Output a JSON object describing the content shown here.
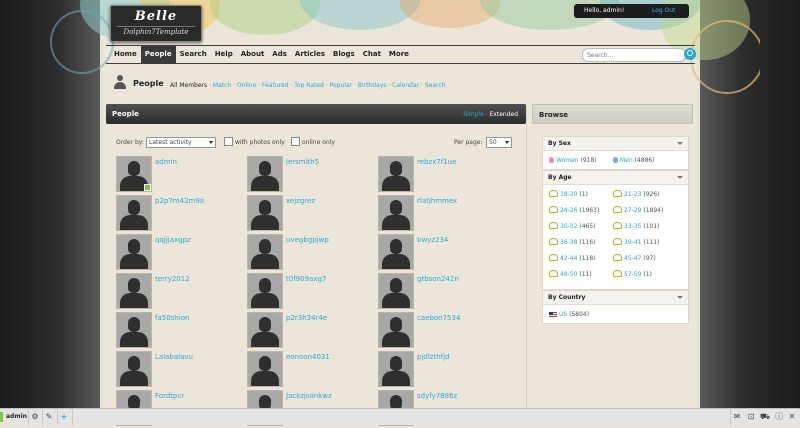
{
  "logo": {
    "title": "Belle",
    "subtitle": "Dolphin7Template"
  },
  "user": {
    "greeting": "Hello, admin!",
    "logout": "Log Out"
  },
  "nav": {
    "items": [
      "Home",
      "People",
      "Search",
      "Help",
      "About",
      "Ads",
      "Articles",
      "Blogs",
      "Chat",
      "More"
    ],
    "active": "People",
    "search_placeholder": "Search..."
  },
  "page": {
    "title": "People",
    "submenu": [
      "All Members",
      "Match",
      "Online",
      "Featured",
      "Top Rated",
      "Popular",
      "Birthdays",
      "Calendar",
      "Search"
    ]
  },
  "main": {
    "title": "People",
    "view_simple": "Simple",
    "view_extended": "Extended",
    "order_label": "Order by:",
    "order_value": "Latest activity",
    "with_photos": "with photos only",
    "online_only": "online only",
    "per_page_label": "Per page:",
    "per_page_value": "50"
  },
  "members": [
    {
      "name": "admin",
      "online": true
    },
    {
      "name": "jersmith5",
      "online": false
    },
    {
      "name": "rebzx7f1ue",
      "online": false
    },
    {
      "name": "p2p7m42m9a",
      "online": false
    },
    {
      "name": "xejzgrez",
      "online": false
    },
    {
      "name": "rlatjhmmex",
      "online": false
    },
    {
      "name": "qqjjjaxgpz",
      "online": false
    },
    {
      "name": "uvegbgpjwp",
      "online": false
    },
    {
      "name": "bwyz234",
      "online": false
    },
    {
      "name": "terry2012",
      "online": false
    },
    {
      "name": "t0f909axg7",
      "online": false
    },
    {
      "name": "gtbson242n",
      "online": false
    },
    {
      "name": "fa50shion",
      "online": false
    },
    {
      "name": "p2r3h34r4e",
      "online": false
    },
    {
      "name": "caebon7534",
      "online": false
    },
    {
      "name": "Lalabalavu",
      "online": false
    },
    {
      "name": "eonoon4031",
      "online": false
    },
    {
      "name": "pjdlzthfjd",
      "online": false
    },
    {
      "name": "Fordtpcr",
      "online": false
    },
    {
      "name": "Jackzjsonkwz",
      "online": false
    },
    {
      "name": "sdyfy7886z",
      "online": false
    }
  ],
  "browse": {
    "title": "Browse",
    "by_sex": {
      "title": "By Sex",
      "items": [
        {
          "label": "Women",
          "count": "(918)"
        },
        {
          "label": "Men",
          "count": "(4886)"
        }
      ]
    },
    "by_age": {
      "title": "By Age",
      "items": [
        {
          "label": "18-20",
          "count": "(1)"
        },
        {
          "label": "21-23",
          "count": "(926)"
        },
        {
          "label": "24-26",
          "count": "(1963)"
        },
        {
          "label": "27-29",
          "count": "(1894)"
        },
        {
          "label": "30-32",
          "count": "(465)"
        },
        {
          "label": "33-35",
          "count": "(101)"
        },
        {
          "label": "36-38",
          "count": "(116)"
        },
        {
          "label": "39-41",
          "count": "(111)"
        },
        {
          "label": "42-44",
          "count": "(118)"
        },
        {
          "label": "45-47",
          "count": "(97)"
        },
        {
          "label": "48-50",
          "count": "(11)"
        },
        {
          "label": "57-59",
          "count": "(1)"
        }
      ]
    },
    "by_country": {
      "title": "By Country",
      "items": [
        {
          "label": "US",
          "count": "(5804)"
        }
      ]
    }
  },
  "bottom": {
    "user": "admin"
  },
  "colors": {
    "link": "#2ba6d6",
    "online": "#7ac943",
    "header_dark": "#2c2c2c"
  }
}
